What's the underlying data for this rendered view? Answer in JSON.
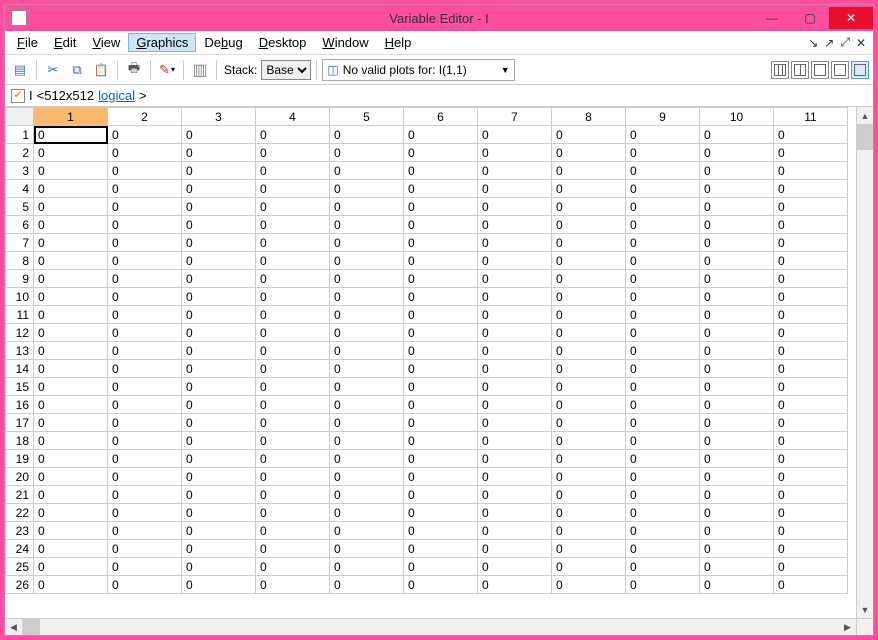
{
  "window": {
    "title": "Variable Editor - I",
    "controls": {
      "min": "―",
      "max": "▢",
      "close": "✕"
    }
  },
  "menus": {
    "file": "File",
    "edit": "Edit",
    "view": "View",
    "graphics": "Graphics",
    "debug": "Debug",
    "desktop": "Desktop",
    "window": "Window",
    "help": "Help"
  },
  "dock": {
    "sw": "↘",
    "up": "↗",
    "de": "⤢",
    "cl": "✕"
  },
  "toolbar": {
    "stack_label": "Stack:",
    "stack_value": "Base",
    "plot_label": "No valid plots for: I(1,1)"
  },
  "var": {
    "name": "I",
    "size": "<512x512",
    "type": "logical",
    "close": ">"
  },
  "grid": {
    "cols": [
      1,
      2,
      3,
      4,
      5,
      6,
      7,
      8,
      9,
      10,
      11
    ],
    "rows": 26,
    "selected_col": 1,
    "selected_row": 1,
    "value": 0
  }
}
